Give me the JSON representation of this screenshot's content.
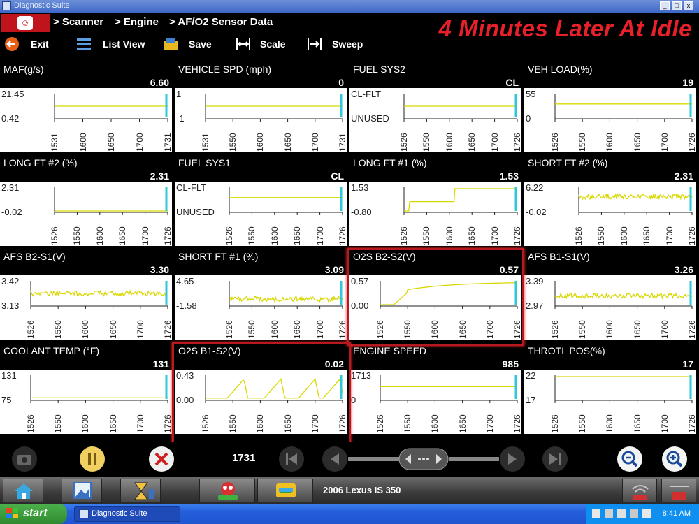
{
  "window": {
    "title": "Diagnostic Suite"
  },
  "breadcrumb": {
    "items": [
      "> Scanner",
      "> Engine",
      "> AF/O2 Sensor Data"
    ]
  },
  "overlay_title": "4 Minutes Later  At Idle",
  "toolbar": {
    "exit": "Exit",
    "list_view": "List View",
    "save": "Save",
    "scale": "Scale",
    "sweep": "Sweep"
  },
  "panels": [
    {
      "name": "MAF(g/s)",
      "value": "6.60",
      "ylabels": [
        "21.45",
        "0.42"
      ],
      "xlabels": [
        "1531",
        "1600",
        "1650",
        "1700",
        "1731"
      ],
      "shape": "flat",
      "level": 0.5
    },
    {
      "name": "VEHICLE SPD (mph)",
      "value": "0",
      "ylabels": [
        "1",
        "-1"
      ],
      "xlabels": [
        "1531",
        "1550",
        "1600",
        "1650",
        "1700",
        "1731"
      ],
      "shape": "flat",
      "level": 0.5
    },
    {
      "name": "FUEL SYS2",
      "value": "CL",
      "ylabels": [
        "CL-FLT",
        "UNUSED"
      ],
      "xlabels": [
        "1526",
        "1550",
        "1600",
        "1650",
        "1700",
        "1726"
      ],
      "shape": "flat",
      "level": 0.5
    },
    {
      "name": "VEH LOAD(%)",
      "value": "19",
      "ylabels": [
        "55",
        "0"
      ],
      "xlabels": [
        "1526",
        "1550",
        "1600",
        "1650",
        "1700",
        "1726"
      ],
      "shape": "flat",
      "level": 0.6
    },
    {
      "name": "LONG FT #2 (%)",
      "value": "2.31",
      "ylabels": [
        "2.31",
        "-0.02"
      ],
      "xlabels": [
        "1526",
        "1550",
        "1600",
        "1650",
        "1700",
        "1726"
      ],
      "shape": "flat",
      "level": 0.0
    },
    {
      "name": "FUEL SYS1",
      "value": "CL",
      "ylabels": [
        "CL-FLT",
        "UNUSED"
      ],
      "xlabels": [
        "1526",
        "1550",
        "1600",
        "1650",
        "1700",
        "1726"
      ],
      "shape": "flat",
      "level": 0.6
    },
    {
      "name": "LONG FT #1 (%)",
      "value": "1.53",
      "ylabels": [
        "1.53",
        "-0.80"
      ],
      "xlabels": [
        "1526",
        "1550",
        "1600",
        "1650",
        "1700",
        "1726"
      ],
      "shape": "steps",
      "level": 0.0
    },
    {
      "name": "SHORT FT #2 (%)",
      "value": "2.31",
      "ylabels": [
        "6.22",
        "-0.02"
      ],
      "xlabels": [
        "1526",
        "1550",
        "1600",
        "1650",
        "1700",
        "1726"
      ],
      "shape": "noisy",
      "level": 0.65
    },
    {
      "name": "AFS B2-S1(V)",
      "value": "3.30",
      "ylabels": [
        "3.42",
        "3.13"
      ],
      "xlabels": [
        "1526",
        "1550",
        "1600",
        "1650",
        "1700",
        "1726"
      ],
      "shape": "noisy",
      "level": 0.5
    },
    {
      "name": "SHORT FT #1 (%)",
      "value": "3.09",
      "ylabels": [
        "4.65",
        "-1.58"
      ],
      "xlabels": [
        "1526",
        "1550",
        "1600",
        "1650",
        "1700",
        "1726"
      ],
      "shape": "noisy",
      "level": 0.25
    },
    {
      "name": "O2S B2-S2(V)",
      "value": "0.57",
      "ylabels": [
        "0.57",
        "0.00"
      ],
      "xlabels": [
        "1526",
        "1550",
        "1600",
        "1650",
        "1700",
        "1726"
      ],
      "shape": "rise",
      "level": 0.0
    },
    {
      "name": "AFS B1-S1(V)",
      "value": "3.26",
      "ylabels": [
        "3.39",
        "2.97"
      ],
      "xlabels": [
        "1526",
        "1550",
        "1600",
        "1650",
        "1700",
        "1726"
      ],
      "shape": "noisy",
      "level": 0.4
    },
    {
      "name": "COOLANT TEMP (°F)",
      "value": "131",
      "ylabels": [
        "131",
        "75"
      ],
      "xlabels": [
        "1526",
        "1550",
        "1600",
        "1650",
        "1700",
        "1726"
      ],
      "shape": "flat",
      "level": 0.05
    },
    {
      "name": "O2S B1-S2(V)",
      "value": "0.02",
      "ylabels": [
        "0.43",
        "0.00"
      ],
      "xlabels": [
        "1526",
        "1550",
        "1600",
        "1650",
        "1700",
        "1726"
      ],
      "shape": "waves",
      "level": 0.0
    },
    {
      "name": "ENGINE SPEED",
      "value": "985",
      "ylabels": [
        "1713",
        "0"
      ],
      "xlabels": [
        "1526",
        "1550",
        "1600",
        "1650",
        "1700",
        "1726"
      ],
      "shape": "flat",
      "level": 0.55
    },
    {
      "name": "THROTL POS(%)",
      "value": "17",
      "ylabels": [
        "22",
        "17"
      ],
      "xlabels": [
        "1526",
        "1550",
        "1600",
        "1650",
        "1700",
        "1726"
      ],
      "shape": "flat",
      "level": 1.0
    }
  ],
  "controls": {
    "frame_counter": "1731"
  },
  "appbar": {
    "vehicle": "2006 Lexus IS 350"
  },
  "taskbar": {
    "start": "start",
    "task_item": "Diagnostic Suite",
    "clock": "8:41 AM"
  },
  "colors": {
    "trace": "#d8d800",
    "cursor": "#30c8d8",
    "plot_bg": "#ffffff",
    "highlight": "#b81820",
    "overlay": "#e8202a"
  }
}
